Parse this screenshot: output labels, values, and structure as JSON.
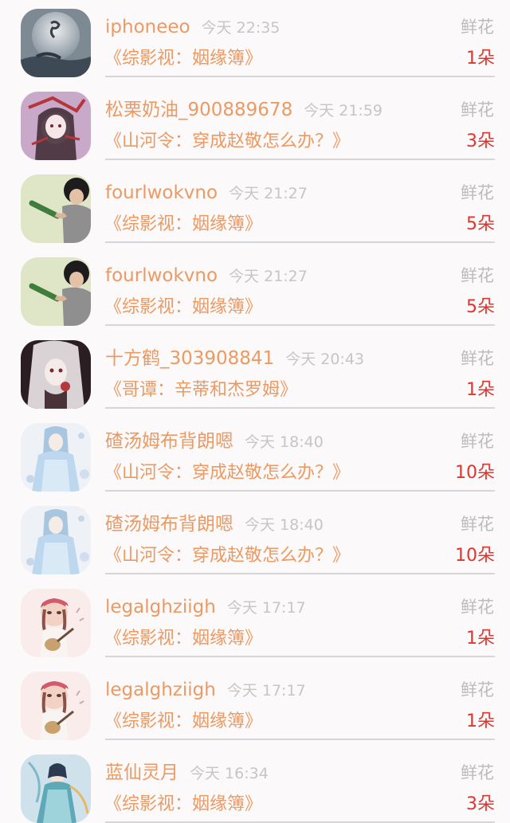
{
  "gift_rows": [
    {
      "user": "iphoneeo",
      "time": "今天 22:35",
      "gift": "鲜花",
      "book": "《综影视：姻缘簿》",
      "count": "1朵",
      "avatar": "avatar-moon-icon"
    },
    {
      "user": "松栗奶油_900889678",
      "time": "今天 21:59",
      "gift": "鲜花",
      "book": "《山河令：穿成赵敬怎么办？》",
      "count": "3朵",
      "avatar": "avatar-anime-red-icon"
    },
    {
      "user": "fourlwokvno",
      "time": "今天 21:27",
      "gift": "鲜花",
      "book": "《综影视：姻缘簿》",
      "count": "5朵",
      "avatar": "avatar-bottle-icon"
    },
    {
      "user": "fourlwokvno",
      "time": "今天 21:27",
      "gift": "鲜花",
      "book": "《综影视：姻缘簿》",
      "count": "5朵",
      "avatar": "avatar-bottle-icon"
    },
    {
      "user": "十方鹤_303908841",
      "time": "今天 20:43",
      "gift": "鲜花",
      "book": "《哥谭：辛蒂和杰罗姆》",
      "count": "1朵",
      "avatar": "avatar-anime-dark-icon"
    },
    {
      "user": "碴汤姆布背朗嗯",
      "time": "今天 18:40",
      "gift": "鲜花",
      "book": "《山河令：穿成赵敬怎么办？》",
      "count": "10朵",
      "avatar": "avatar-anime-blue-icon"
    },
    {
      "user": "碴汤姆布背朗嗯",
      "time": "今天 18:40",
      "gift": "鲜花",
      "book": "《山河令：穿成赵敬怎么办？》",
      "count": "10朵",
      "avatar": "avatar-anime-blue-icon"
    },
    {
      "user": "legalghziigh",
      "time": "今天 17:17",
      "gift": "鲜花",
      "book": "《综影视：姻缘簿》",
      "count": "1朵",
      "avatar": "avatar-girl-guitar-icon"
    },
    {
      "user": "legalghziigh",
      "time": "今天 17:17",
      "gift": "鲜花",
      "book": "《综影视：姻缘簿》",
      "count": "1朵",
      "avatar": "avatar-girl-guitar-icon"
    },
    {
      "user": "蓝仙灵月",
      "time": "今天 16:34",
      "gift": "鲜花",
      "book": "《综影视：姻缘簿》",
      "count": "3朵",
      "avatar": "avatar-fairy-icon"
    }
  ],
  "colors": {
    "username": "#ec9a63",
    "time": "#c6c6c6",
    "gift_label": "#bcbcbc",
    "count": "#e3342e",
    "background": "#fbf9fa",
    "divider": "#d7d7d7"
  }
}
